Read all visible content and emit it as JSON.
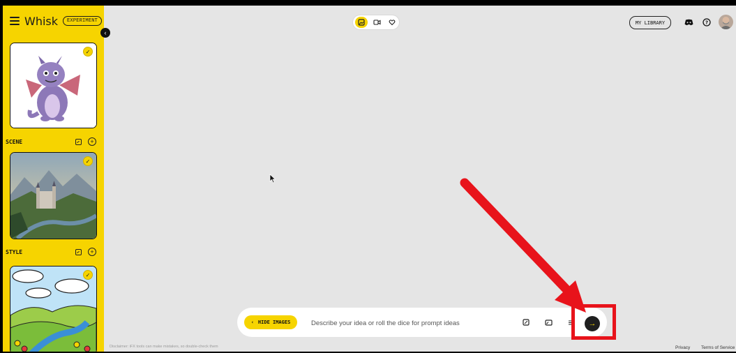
{
  "app": {
    "name": "Whisk",
    "badge": "EXPERIMENT"
  },
  "sidebar": {
    "sections": [
      {
        "label": "SCENE"
      },
      {
        "label": "STYLE"
      }
    ]
  },
  "header": {
    "library_label": "MY LIBRARY",
    "icons": [
      "image-add-icon",
      "video-icon",
      "heart-icon",
      "discord-icon",
      "help-icon",
      "avatar"
    ]
  },
  "prompt": {
    "hide_label": "HIDE IMAGES",
    "placeholder": "Describe your idea or roll the dice for prompt ideas"
  },
  "footer": {
    "disclaimer": "Disclaimer: iFX tools can make mistakes, so double-check them",
    "privacy": "Privacy",
    "terms": "Terms of Service"
  },
  "colors": {
    "accent": "#f6d400",
    "canvas": "#e5e5e5",
    "annotation": "#e8131b"
  }
}
